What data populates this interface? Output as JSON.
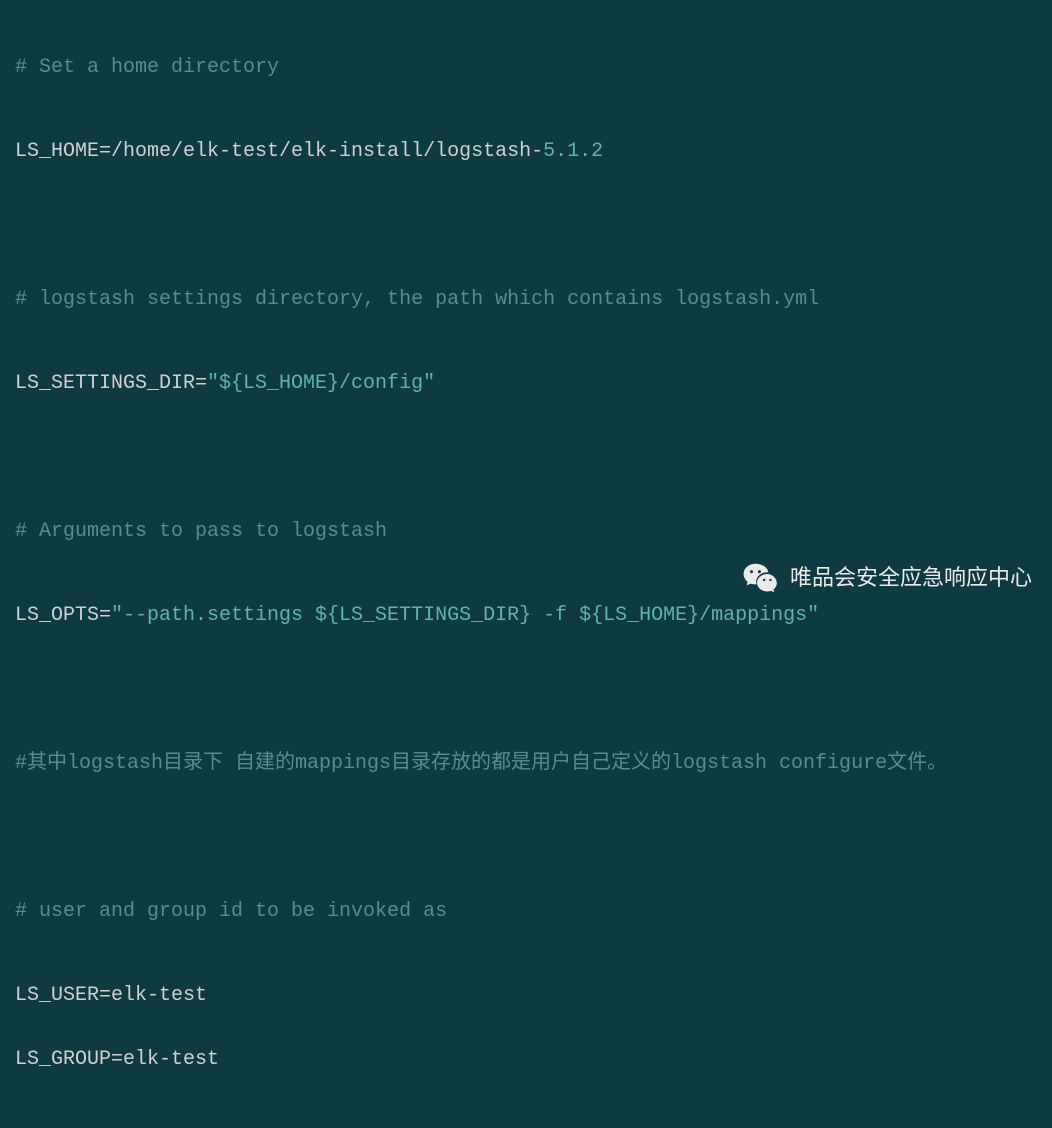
{
  "code": {
    "comment1": "# Set a home directory",
    "line1_prefix": "LS_HOME=/home/elk-test/elk-install/logstash-",
    "line1_version": "5.1.2",
    "comment2": "# logstash settings directory, the path which contains logstash.yml",
    "line2_key": "LS_SETTINGS_DIR=",
    "line2_val": "\"${LS_HOME}/config\"",
    "comment3": "# Arguments to pass to logstash",
    "line3_key": "LS_OPTS=",
    "line3_val": "\"--path.settings ${LS_SETTINGS_DIR} -f ${LS_HOME}/mappings\"",
    "comment4": "#其中logstash目录下 自建的mappings目录存放的都是用户自己定义的logstash configure文件。",
    "comment5": "# user and group id to be invoked as",
    "line5": "LS_USER=elk-test",
    "line6": "LS_GROUP=elk-test"
  },
  "watermark": {
    "text": "唯品会安全应急响应中心"
  }
}
